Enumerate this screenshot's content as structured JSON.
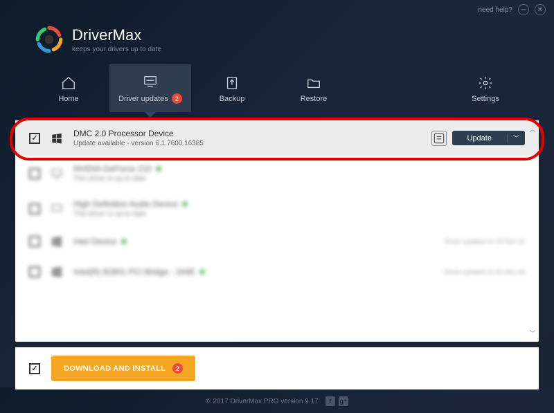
{
  "titlebar": {
    "help": "need help?"
  },
  "brand": {
    "title": "DriverMax",
    "subtitle": "keeps your drivers up to date"
  },
  "nav": {
    "home": "Home",
    "updates": "Driver updates",
    "updates_badge": "2",
    "backup": "Backup",
    "restore": "Restore",
    "settings": "Settings"
  },
  "rows": {
    "r0": {
      "title": "DMC 2.0 Processor Device",
      "sub": "Update available - version 6.1.7600.16385",
      "update": "Update"
    },
    "r1": {
      "title": "NVIDIA GeForce 210",
      "sub": "This driver is up-to-date"
    },
    "r2": {
      "title": "High Definition Audio Device",
      "sub": "This driver is up-to-date"
    },
    "r3": {
      "title": "Intel Device",
      "sub": "",
      "right": "Driver updated on 03-Nov-16"
    },
    "r4": {
      "title": "Intel(R) 82801 PCI Bridge - 244E",
      "sub": "",
      "right": "Driver updated on 03-Nov-16"
    }
  },
  "footer": {
    "download": "DOWNLOAD AND INSTALL",
    "download_badge": "2"
  },
  "copyright": "© 2017 DriverMax PRO version 9.17"
}
